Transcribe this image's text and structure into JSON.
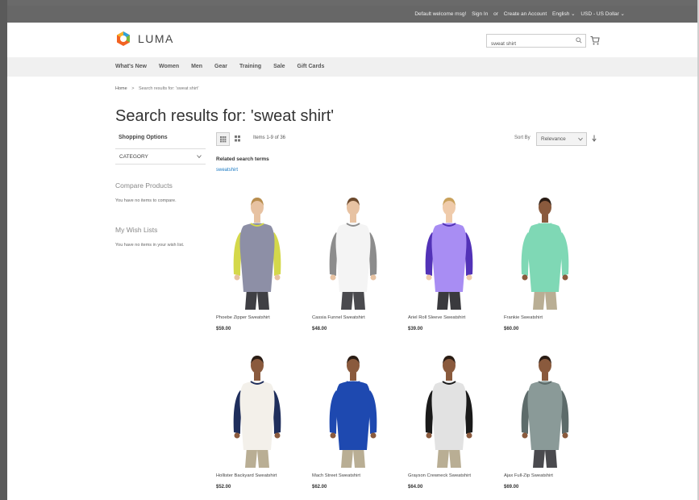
{
  "header": {
    "welcome": "Default welcome msg!",
    "sign_in": "Sign In",
    "or": "or",
    "create_account": "Create an Account",
    "language": "English ⌄",
    "currency": "USD - US Dollar ⌄",
    "logo_text": "LUMA"
  },
  "search": {
    "value": "sweat shirt"
  },
  "nav": [
    "What's New",
    "Women",
    "Men",
    "Gear",
    "Training",
    "Sale",
    "Gift Cards"
  ],
  "breadcrumb": {
    "home": "Home",
    "separator": ">",
    "current": "Search results for: 'sweat shirt'"
  },
  "page_title": "Search results for: 'sweat shirt'",
  "sidebar": {
    "shopping_options": "Shopping Options",
    "category": "CATEGORY",
    "compare_title": "Compare Products",
    "compare_text": "You have no items to compare.",
    "wish_title": "My Wish Lists",
    "wish_text": "You have no items in your wish list."
  },
  "toolbar": {
    "items_count": "Items 1-9 of 36",
    "sort_label": "Sort By",
    "sort_value": "Relevance"
  },
  "related": {
    "title": "Related search terms",
    "term": "sweatshirt"
  },
  "products": [
    {
      "name": "Phoebe Zipper Sweatshirt",
      "price": "$59.00",
      "color": "#8d8fa6",
      "accent": "#d4d84a",
      "skin": "#e7c2a2",
      "hair": "#b88d4e",
      "pants": "#3f3f44"
    },
    {
      "name": "Cassia Funnel Sweatshirt",
      "price": "$48.00",
      "color": "#f4f4f4",
      "accent": "#8c8c8c",
      "skin": "#e7c2a2",
      "hair": "#6d4a2d",
      "pants": "#4a4a4e"
    },
    {
      "name": "Ariel Roll Sleeve Sweatshirt",
      "price": "$39.00",
      "color": "#a88df3",
      "accent": "#5232b7",
      "skin": "#efcbab",
      "hair": "#c9a15b",
      "pants": "#3a3a3e"
    },
    {
      "name": "Frankie Sweatshirt",
      "price": "$60.00",
      "color": "#7fd8b5",
      "accent": "#7fd8b5",
      "skin": "#8a5a3d",
      "hair": "#2a1c14",
      "pants": "#b9ae94"
    },
    {
      "name": "Hollister Backyard Sweatshirt",
      "price": "$52.00",
      "color": "#f3f0ea",
      "accent": "#1f2e5c",
      "skin": "#8a5a3d",
      "hair": "#2a1c14",
      "pants": "#b9ae94"
    },
    {
      "name": "Mach Street Sweatshirt",
      "price": "$62.00",
      "color": "#1e49b0",
      "accent": "#1e49b0",
      "skin": "#8a5a3d",
      "hair": "#2a1c14",
      "pants": "#b9ae94"
    },
    {
      "name": "Grayson Crewneck Sweatshirt",
      "price": "$64.00",
      "color": "#e2e2e2",
      "accent": "#1a1a1a",
      "skin": "#8a5a3d",
      "hair": "#2a1c14",
      "pants": "#b9ae94"
    },
    {
      "name": "Ajax Full-Zip Sweatshirt",
      "price": "$69.00",
      "color": "#8a9a98",
      "accent": "#5d6b6a",
      "skin": "#8a5a3d",
      "hair": "#2a1c14",
      "pants": "#4a4a4e"
    }
  ]
}
